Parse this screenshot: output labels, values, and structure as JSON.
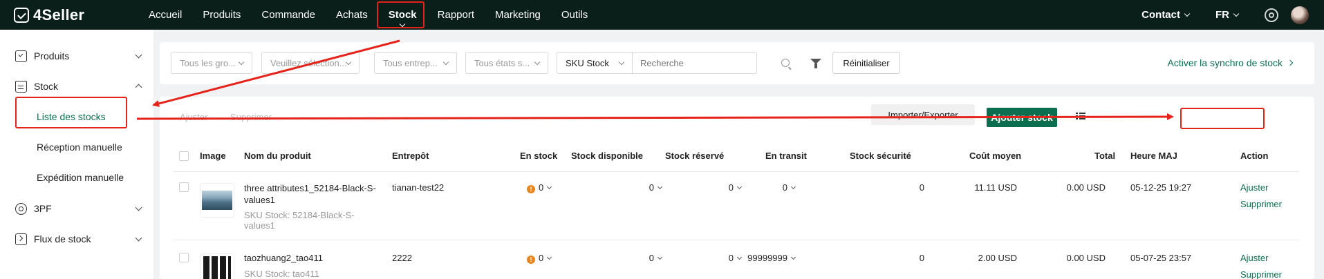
{
  "app": {
    "name": "4Seller"
  },
  "nav": {
    "items": [
      "Accueil",
      "Produits",
      "Commande",
      "Achats",
      "Stock",
      "Rapport",
      "Marketing",
      "Outils"
    ],
    "active": "Stock",
    "contact": "Contact",
    "language": "FR"
  },
  "sidebar": {
    "produits": "Produits",
    "stock": "Stock",
    "sub": [
      "Liste des stocks",
      "Réception manuelle",
      "Expédition manuelle"
    ],
    "tpf": "3PF",
    "flux": "Flux de stock"
  },
  "filters": {
    "group": "Tous les gro...",
    "select": "Veuillez sélection...",
    "warehouse": "Tous entrep...",
    "states": "Tous états s...",
    "sku_type": "SKU Stock",
    "search_placeholder": "Recherche",
    "reset": "Réinitialiser",
    "sync": "Activer la synchro de stock"
  },
  "toolbar": {
    "adjust": "Ajuster",
    "delete": "Supprimer",
    "import_export": "Importer/Exporter",
    "add_stock": "Ajouter stock"
  },
  "table": {
    "headers": [
      "Image",
      "Nom du produit",
      "Entrepôt",
      "En stock",
      "Stock disponible",
      "Stock réservé",
      "En transit",
      "Stock sécurité",
      "Coût moyen",
      "Total",
      "Heure MAJ",
      "Action"
    ],
    "rows": [
      {
        "name": "three attributes1_52184-Black-S-values1",
        "sku": "SKU Stock: 52184-Black-S-values1",
        "warehouse": "tianan-test22",
        "in_stock": "0",
        "available": "0",
        "reserved": "0",
        "transit": "0",
        "safety": "0",
        "avg_cost": "11.11",
        "avg_cost_cur": "USD",
        "total": "0.00",
        "total_cur": "USD",
        "updated": "05-12-25 19:27",
        "action_adjust": "Ajuster",
        "action_delete": "Supprimer"
      },
      {
        "name": "taozhuang2_tao411",
        "sku": "SKU Stock: tao411",
        "warehouse": "2222",
        "in_stock": "0",
        "available": "0",
        "reserved": "0",
        "transit": "99999999",
        "safety": "0",
        "avg_cost": "2.00",
        "avg_cost_cur": "USD",
        "total": "0.00",
        "total_cur": "USD",
        "updated": "05-07-25 23:57",
        "action_adjust": "Ajuster",
        "action_delete": "Supprimer"
      }
    ]
  },
  "colors": {
    "topbar": "#0a1e1a",
    "brand": "#0b6e4f",
    "annotation": "#e5231b"
  }
}
